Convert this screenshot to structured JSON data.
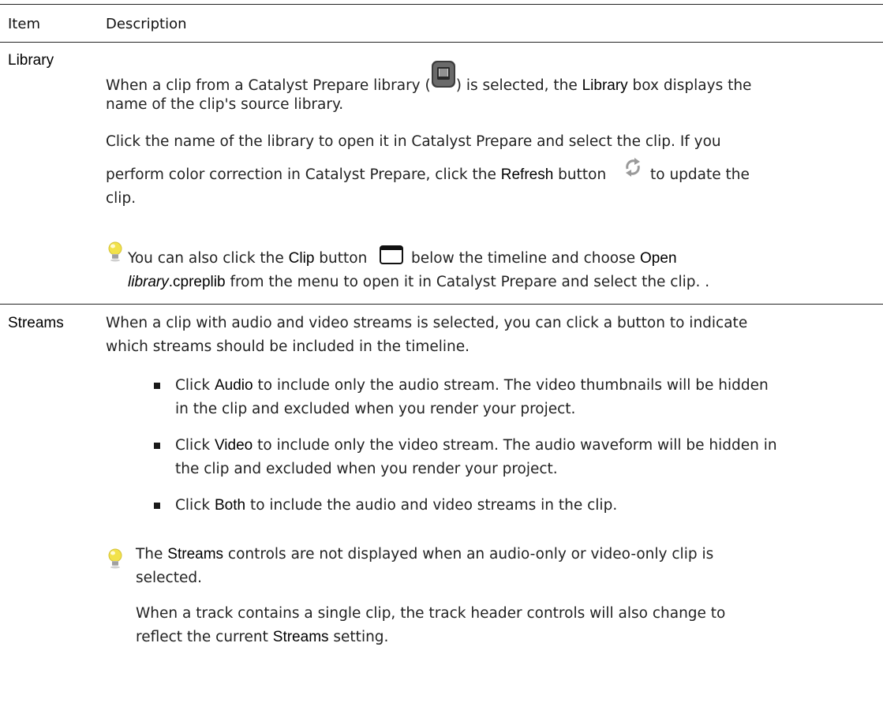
{
  "table": {
    "headers": {
      "item": "Item",
      "description": "Description"
    },
    "library": {
      "label": "Library",
      "p1": {
        "a": "When a clip from a Catalyst Prepare library (",
        "b": ") is selected, the ",
        "c": "Library",
        "d": " box displays the",
        "e": "name of the clip's source library."
      },
      "p2": {
        "a": "Click the name of the library to open it in Catalyst Prepare and select the clip. If you",
        "b": "perform color correction in Catalyst Prepare, click the ",
        "c": "Refresh",
        "d": " button",
        "e": "to update the",
        "f": "clip."
      },
      "tip": {
        "a": "You can also click the ",
        "b": "Clip",
        "c": " button",
        "d": "below the timeline and choose ",
        "e": "Open",
        "f": "library",
        "g": ".cpreplib",
        "h": " from the menu to open it in Catalyst Prepare and select the clip. ."
      }
    },
    "streams": {
      "label": "Streams",
      "p1": {
        "a": "When a clip with audio and video streams is selected, you can click a button to indicate",
        "b": "which streams should be included in the timeline."
      },
      "bullets": [
        {
          "a": "Click ",
          "b": "Audio",
          "c": " to include only the audio stream. The video thumbnails will be hidden",
          "d": "in the clip and excluded when you render your project."
        },
        {
          "a": "Click ",
          "b": "Video",
          "c": " to include only the video stream. The audio waveform will be hidden in",
          "d": "the clip and excluded when you render your project."
        },
        {
          "a": "Click ",
          "b": "Both",
          "c": " to include the audio and video streams in the clip.",
          "d": ""
        }
      ],
      "tip": {
        "a": "The ",
        "b": "Streams",
        "c": " controls are not displayed when an audio-only or video-only clip is",
        "d": "selected."
      },
      "p2": {
        "a": "When a track contains a single clip, the track header controls will also change to",
        "b": "reflect the current ",
        "c": "Streams",
        "d": " setting."
      }
    }
  },
  "icons": {
    "library": "library-icon",
    "refresh": "refresh-icon",
    "clip": "clip-button-icon",
    "tip": "lightbulb-tip-icon"
  },
  "colors": {
    "bulb": "#f2e24a",
    "refresh": "#9a9a9a",
    "library_icon": "#3d3d3d"
  }
}
